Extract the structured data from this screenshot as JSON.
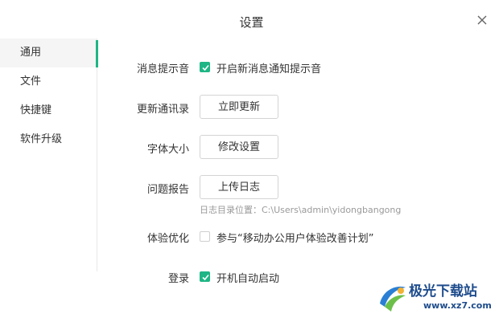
{
  "window": {
    "title": "设置"
  },
  "sidebar": {
    "items": [
      {
        "label": "通用",
        "active": true
      },
      {
        "label": "文件",
        "active": false
      },
      {
        "label": "快捷键",
        "active": false
      },
      {
        "label": "软件升级",
        "active": false
      }
    ]
  },
  "settings": {
    "notification_sound": {
      "label": "消息提示音",
      "option_label": "开启新消息通知提示音",
      "checked": true
    },
    "update_contacts": {
      "label": "更新通讯录",
      "button_label": "立即更新"
    },
    "font_size": {
      "label": "字体大小",
      "button_label": "修改设置"
    },
    "problem_report": {
      "label": "问题报告",
      "button_label": "上传日志",
      "log_path_hint": "日志目录位置：C:\\Users\\admin\\yidongbangong"
    },
    "experience": {
      "label": "体验优化",
      "option_label": "参与“移动办公用户体验改善计划”",
      "checked": false
    },
    "login": {
      "label": "登录",
      "option_label": "开机自动启动",
      "checked": true
    }
  },
  "watermark": {
    "text": "极光下载站",
    "url": "www.xz7.com"
  },
  "colors": {
    "accent": "#1fb585",
    "text": "#333333",
    "hint": "#9a9a9a",
    "border": "#d4d4d4"
  }
}
